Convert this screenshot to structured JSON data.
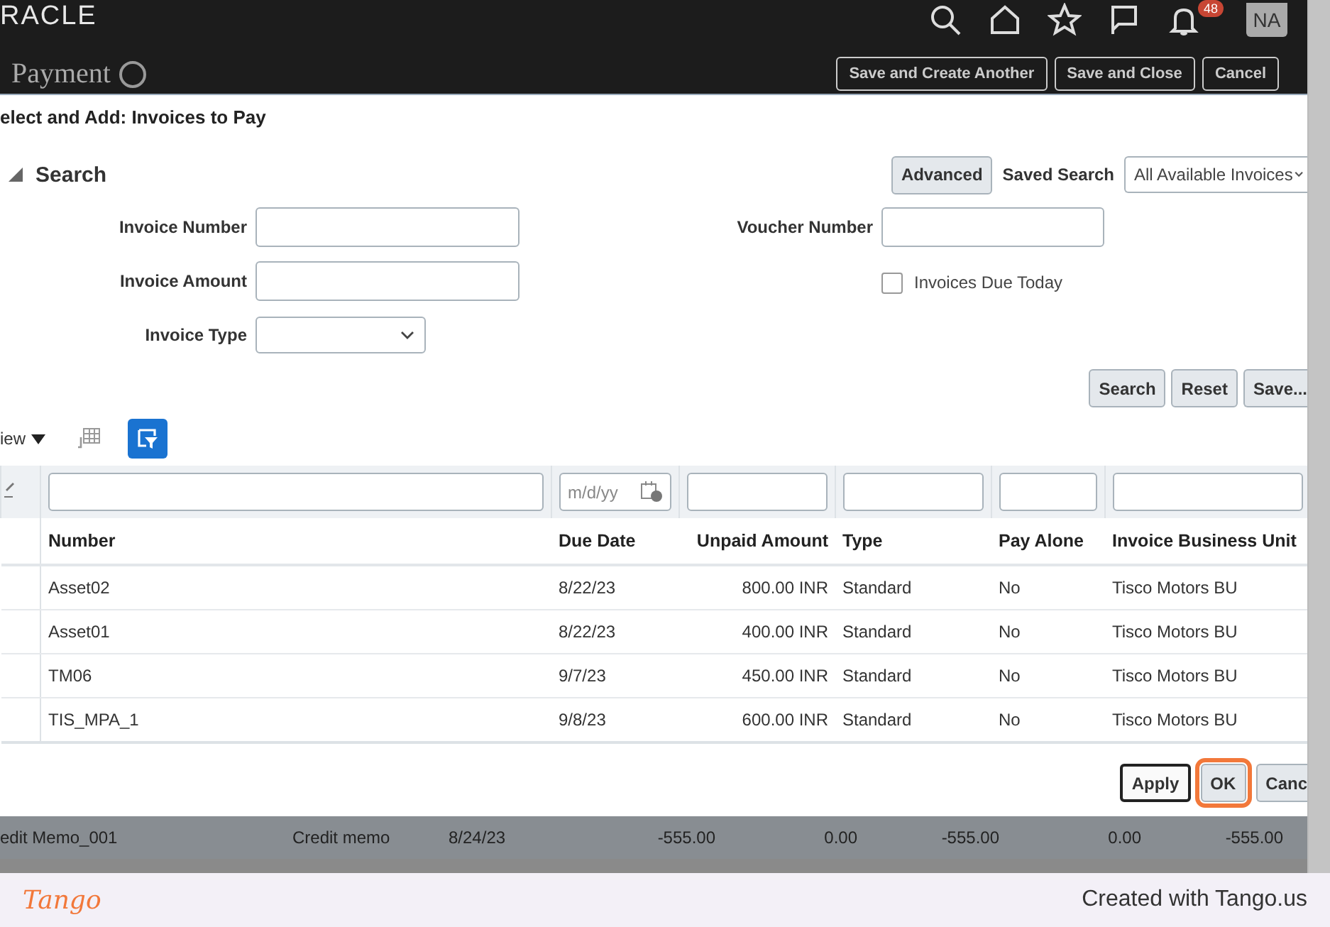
{
  "app_header": {
    "logo": "RACLE",
    "notification_count": "48",
    "avatar": "NA",
    "page_title": "Payment",
    "buttons": [
      "Save and Create Another",
      "Save and Close",
      "Cancel"
    ]
  },
  "dialog": {
    "title": "elect and Add: Invoices to Pay",
    "search": {
      "title": "Search",
      "expanded": true,
      "advanced_button": "Advanced",
      "saved_search_label": "Saved Search",
      "saved_search_value": "All Available Invoices",
      "left_fields": [
        {
          "label": "Invoice Number",
          "kind": "text"
        },
        {
          "label": "Invoice Amount",
          "kind": "text"
        },
        {
          "label": "Invoice Type",
          "kind": "select"
        }
      ],
      "right_fields": [
        {
          "label": "Voucher Number",
          "kind": "text"
        },
        {
          "label": "Invoices Due Today",
          "kind": "checkbox",
          "checked": false
        }
      ],
      "buttons": [
        "Search",
        "Reset",
        "Save..."
      ]
    },
    "toolbar": {
      "view_menu": "iew",
      "filter_selected": true
    },
    "table": {
      "filters": [
        {
          "kind": "text"
        },
        {
          "kind": "date",
          "placeholder": "m/d/yy"
        },
        {
          "kind": "text"
        },
        {
          "kind": "text"
        },
        {
          "kind": "text"
        },
        {
          "kind": "text"
        }
      ],
      "columns": [
        {
          "label": "Number",
          "kind": "text"
        },
        {
          "label": "Due Date",
          "kind": "text"
        },
        {
          "label": "Unpaid Amount",
          "kind": "amount"
        },
        {
          "label": "Type",
          "kind": "text"
        },
        {
          "label": "Pay Alone",
          "kind": "text"
        },
        {
          "label": "Invoice Business Unit",
          "kind": "text"
        }
      ],
      "rows": [
        [
          "Asset02",
          "8/22/23",
          "800.00 INR",
          "Standard",
          "No",
          "Tisco Motors BU"
        ],
        [
          "Asset01",
          "8/22/23",
          "400.00 INR",
          "Standard",
          "No",
          "Tisco Motors BU"
        ],
        [
          "TM06",
          "9/7/23",
          "450.00 INR",
          "Standard",
          "No",
          "Tisco Motors BU"
        ],
        [
          "TIS_MPA_1",
          "9/8/23",
          "600.00 INR",
          "Standard",
          "No",
          "Tisco Motors BU"
        ]
      ]
    },
    "buttons": [
      {
        "label": "Apply",
        "highlighted": false
      },
      {
        "label": "OK",
        "highlighted": true
      },
      {
        "label": "Canc",
        "highlighted": false
      }
    ]
  },
  "background_row": [
    "edit Memo_001",
    "Credit memo",
    "8/24/23",
    "-555.00",
    "0.00",
    "-555.00",
    "0.00",
    "-555.00"
  ],
  "footer": {
    "logo": "Tango",
    "credit": "Created with Tango.us"
  }
}
